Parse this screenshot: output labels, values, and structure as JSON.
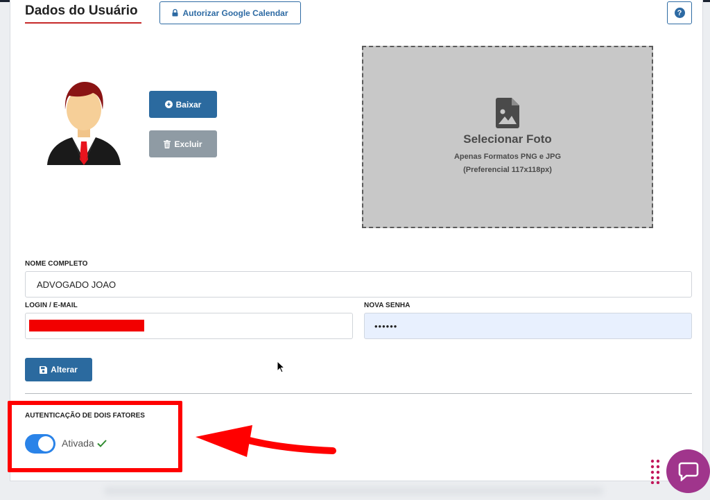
{
  "header": {
    "title": "Dados do Usuário",
    "google_button": "Autorizar Google Calendar",
    "help_icon_glyph": "?"
  },
  "photo": {
    "download_button": "Baixar",
    "delete_button": "Excluir",
    "dropzone_title": "Selecionar Foto",
    "dropzone_line1": "Apenas Formatos PNG e JPG",
    "dropzone_line2": "(Preferencial 117x118px)"
  },
  "form": {
    "name_label": "NOME COMPLETO",
    "name_value": "ADVOGADO JOAO",
    "login_label": "LOGIN / E-MAIL",
    "password_label": "NOVA SENHA",
    "password_value": "••••••",
    "submit_button": "Alterar"
  },
  "two_factor": {
    "title": "AUTENTICAÇÃO DE DOIS FATORES",
    "status": "Ativada",
    "enabled": true
  },
  "icons": {
    "lock": "lock-icon",
    "help": "help-icon",
    "download": "download-circle-icon",
    "trash": "trash-icon",
    "image_file": "image-file-icon",
    "save": "save-icon",
    "check": "check-icon",
    "chat": "chat-icon"
  },
  "colors": {
    "primary": "#2b6a9f",
    "secondary": "#8f9ba4",
    "title_underline": "#c62828",
    "toggle_on": "#2a83e8",
    "annotation_red": "#ff0000",
    "chat_widget": "#a0358c"
  }
}
